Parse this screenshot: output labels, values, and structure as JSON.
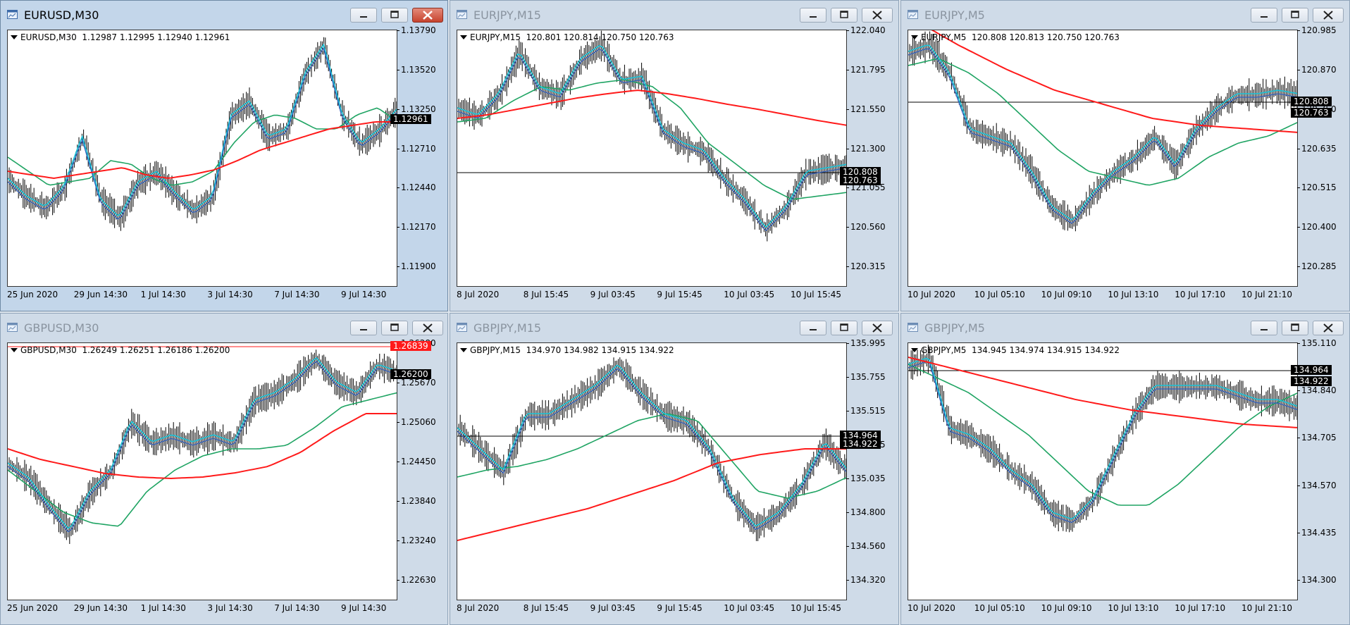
{
  "windows": [
    {
      "id": "eurusd-m30",
      "title": "EURUSD,M30",
      "active": true,
      "ohlc_label": "EURUSD,M30  1.12987 1.12995 1.12940 1.12961",
      "y_ticks": [
        "1.13790",
        "1.13520",
        "1.13250",
        "1.12710",
        "1.12440",
        "1.12170",
        "1.11900"
      ],
      "x_ticks": [
        "25 Jun 2020",
        "29 Jun 14:30",
        "1 Jul 14:30",
        "3 Jul 14:30",
        "7 Jul 14:30",
        "9 Jul 14:30"
      ],
      "price_tags": [
        {
          "text": "1.12961",
          "color": "black"
        }
      ],
      "hline": null
    },
    {
      "id": "eurjpy-m15",
      "title": "EURJPY,M15",
      "active": false,
      "ohlc_label": "EURJPY,M15  120.801 120.814 120.750 120.763",
      "y_ticks": [
        "122.040",
        "121.795",
        "121.550",
        "121.300",
        "121.055",
        "120.560",
        "120.315"
      ],
      "x_ticks": [
        "8 Jul 2020",
        "8 Jul 15:45",
        "9 Jul 03:45",
        "9 Jul 15:45",
        "10 Jul 03:45",
        "10 Jul 15:45"
      ],
      "price_tags": [
        {
          "text": "120.808",
          "color": "black"
        },
        {
          "text": "120.763",
          "color": "black"
        }
      ],
      "hline": "120.808"
    },
    {
      "id": "eurjpy-m5",
      "title": "EURJPY,M5",
      "active": false,
      "ohlc_label": "EURJPY,M5  120.808 120.813 120.750 120.763",
      "y_ticks": [
        "120.985",
        "120.870",
        "120.750",
        "120.635",
        "120.515",
        "120.400",
        "120.285"
      ],
      "x_ticks": [
        "10 Jul 2020",
        "10 Jul 05:10",
        "10 Jul 09:10",
        "10 Jul 13:10",
        "10 Jul 17:10",
        "10 Jul 21:10"
      ],
      "price_tags": [
        {
          "text": "120.808",
          "color": "black"
        },
        {
          "text": "120.763",
          "color": "black"
        }
      ],
      "hline": "120.808"
    },
    {
      "id": "gbpusd-m30",
      "title": "GBPUSD,M30",
      "active": false,
      "ohlc_label": "GBPUSD,M30  1.26249 1.26251 1.26186 1.26200",
      "y_ticks": [
        "1.26280",
        "1.25670",
        "1.25060",
        "1.24450",
        "1.23840",
        "1.23240",
        "1.22630"
      ],
      "x_ticks": [
        "25 Jun 2020",
        "29 Jun 14:30",
        "1 Jul 14:30",
        "3 Jul 14:30",
        "7 Jul 14:30",
        "9 Jul 14:30"
      ],
      "price_tags": [
        {
          "text": "1.26839",
          "color": "red"
        },
        {
          "text": "1.26200",
          "color": "black"
        }
      ],
      "hline": "1.26839"
    },
    {
      "id": "gbpjpy-m15",
      "title": "GBPJPY,M15",
      "active": false,
      "ohlc_label": "GBPJPY,M15  134.970 134.982 134.915 134.922",
      "y_ticks": [
        "135.995",
        "135.755",
        "135.515",
        "135.275",
        "135.035",
        "134.800",
        "134.560",
        "134.320"
      ],
      "x_ticks": [
        "8 Jul 2020",
        "8 Jul 15:45",
        "9 Jul 03:45",
        "9 Jul 15:45",
        "10 Jul 03:45",
        "10 Jul 15:45"
      ],
      "price_tags": [
        {
          "text": "134.964",
          "color": "black"
        },
        {
          "text": "134.922",
          "color": "black"
        }
      ],
      "hline": "134.964"
    },
    {
      "id": "gbpjpy-m5",
      "title": "GBPJPY,M5",
      "active": false,
      "ohlc_label": "GBPJPY,M5  134.945 134.974 134.915 134.922",
      "y_ticks": [
        "135.110",
        "134.840",
        "134.705",
        "134.570",
        "134.435",
        "134.300"
      ],
      "x_ticks": [
        "10 Jul 2020",
        "10 Jul 05:10",
        "10 Jul 09:10",
        "10 Jul 13:10",
        "10 Jul 17:10",
        "10 Jul 21:10"
      ],
      "price_tags": [
        {
          "text": "134.964",
          "color": "black"
        },
        {
          "text": "134.922",
          "color": "black"
        }
      ],
      "hline": "134.964"
    }
  ],
  "colors": {
    "ma_slow": "#ff1a1a",
    "ma_mid": "#1fa463",
    "ma_fast": "#19c3d8",
    "ma_fastest": "#2f5fbf",
    "bars": "#000000"
  },
  "icons": {
    "chart": "chart-window-icon",
    "minimize": "minimize-icon",
    "maximize": "maximize-icon",
    "close": "close-icon"
  }
}
